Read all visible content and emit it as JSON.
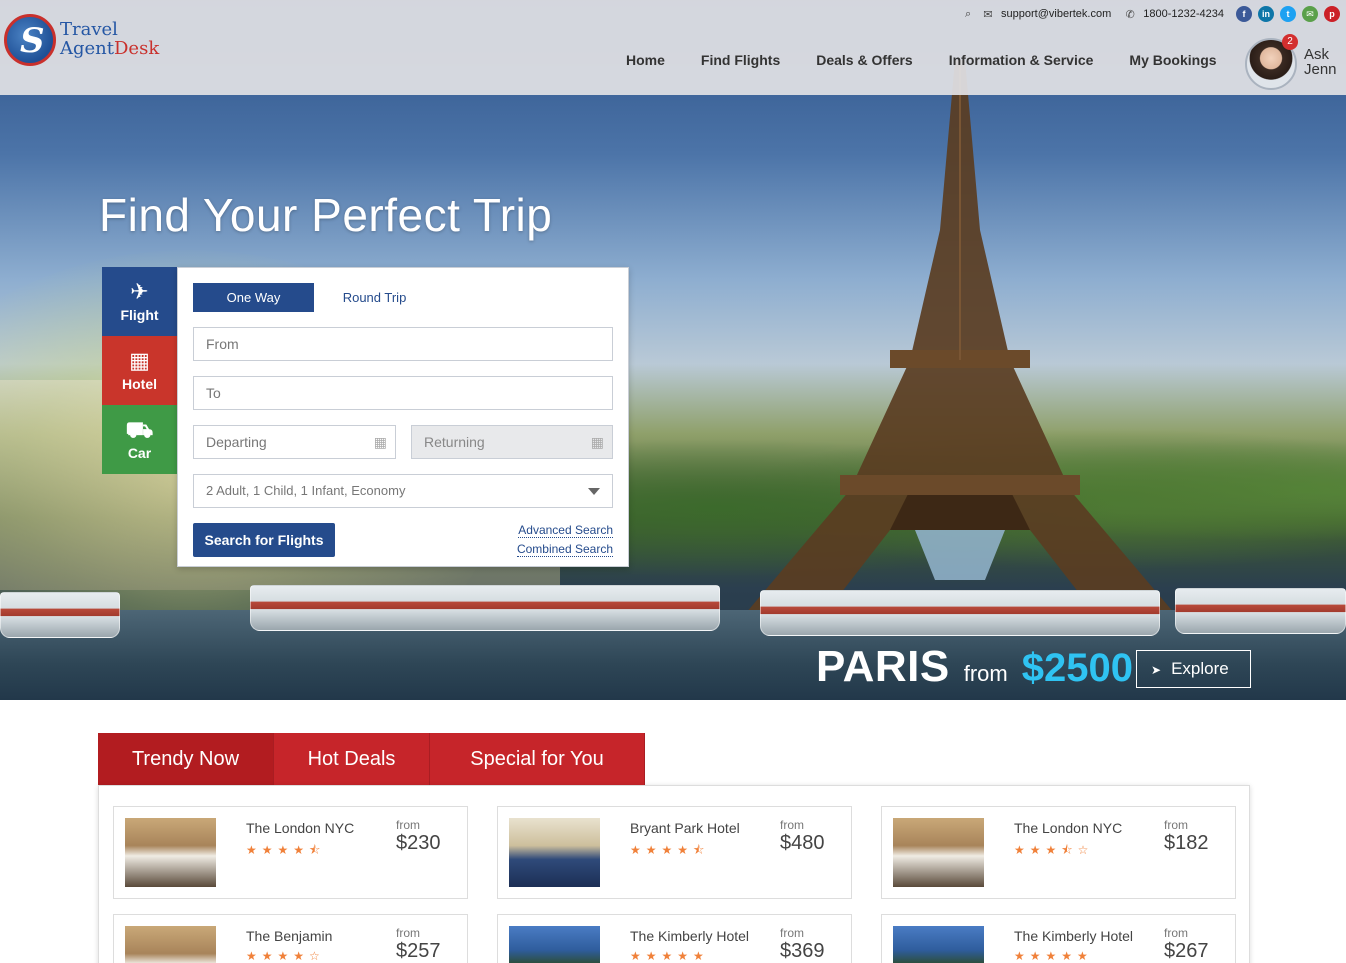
{
  "brand": {
    "line1": "Travel",
    "line2_a": "Agent",
    "line2_b": "Desk"
  },
  "topbar": {
    "email": "support@vibertek.com",
    "phone": "1800-1232-4234"
  },
  "nav": [
    "Home",
    "Find Flights",
    "Deals & Offers",
    "Information & Service",
    "My Bookings"
  ],
  "assistant": {
    "badge": "2",
    "line1": "Ask",
    "line2": "Jenn"
  },
  "hero": {
    "title": "Find Your Perfect Trip"
  },
  "search": {
    "tabs": [
      {
        "label": "Flight",
        "icon": "plane-icon"
      },
      {
        "label": "Hotel",
        "icon": "building-icon"
      },
      {
        "label": "Car",
        "icon": "car-icon"
      }
    ],
    "trip_types": [
      "One Way",
      "Round Trip"
    ],
    "from_placeholder": "From",
    "to_placeholder": "To",
    "departing_placeholder": "Departing",
    "returning_placeholder": "Returning",
    "passengers": "2 Adult, 1 Child, 1 Infant, Economy",
    "submit": "Search for Flights",
    "advanced": "Advanced Search",
    "combined": "Combined Search"
  },
  "promo": {
    "city": "PARIS",
    "from": "from",
    "price": "$2500",
    "explore": "Explore"
  },
  "deal_tabs": [
    "Trendy Now",
    "Hot Deals",
    "Special for You"
  ],
  "deals": [
    {
      "name": "The London NYC",
      "stars": "★★★★⯪",
      "from": "from",
      "price": "$230"
    },
    {
      "name": "Bryant Park Hotel",
      "stars": "★★★★⯪",
      "from": "from",
      "price": "$480"
    },
    {
      "name": "The London NYC",
      "stars": "★★★⯪☆",
      "from": "from",
      "price": "$182"
    },
    {
      "name": "The Benjamin",
      "stars": "★★★★☆",
      "from": "from",
      "price": "$257"
    },
    {
      "name": "The Kimberly Hotel",
      "stars": "★★★★★",
      "from": "from",
      "price": "$369"
    },
    {
      "name": "The Kimberly Hotel",
      "stars": "★★★★★",
      "from": "from",
      "price": "$267"
    }
  ],
  "colors": {
    "primary": "#254b8c",
    "hotel": "#c9352b",
    "car": "#3f9a46",
    "accent_price": "#2fc3f2",
    "deal_red": "#c6252a",
    "stars": "#f0813a"
  }
}
